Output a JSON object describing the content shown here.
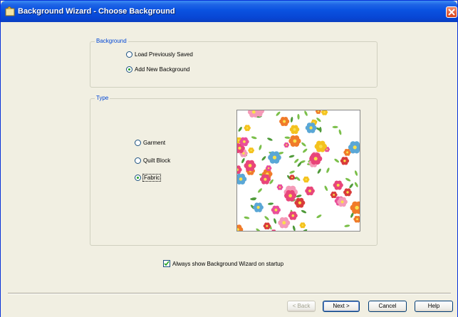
{
  "window": {
    "title": "Background Wizard - Choose Background"
  },
  "background_group": {
    "legend": "Background",
    "options": [
      {
        "label": "Load Previously Saved",
        "checked": false
      },
      {
        "label": "Add New Background",
        "checked": true
      }
    ]
  },
  "type_group": {
    "legend": "Type",
    "options": [
      {
        "label": "Garment",
        "checked": false
      },
      {
        "label": "Quilt Block",
        "checked": false
      },
      {
        "label": "Fabric",
        "checked": true
      }
    ]
  },
  "preview": {
    "icon": "floral-fabric-preview"
  },
  "startup_checkbox": {
    "label": "Always show Background Wizard on startup",
    "checked": true
  },
  "buttons": {
    "back": "< Back",
    "next": "Next >",
    "cancel": "Cancel",
    "help": "Help"
  },
  "colors": {
    "titlebar": "#0a52e0",
    "legend_text": "#0046d5",
    "dialog_bg": "#f1efe2"
  }
}
